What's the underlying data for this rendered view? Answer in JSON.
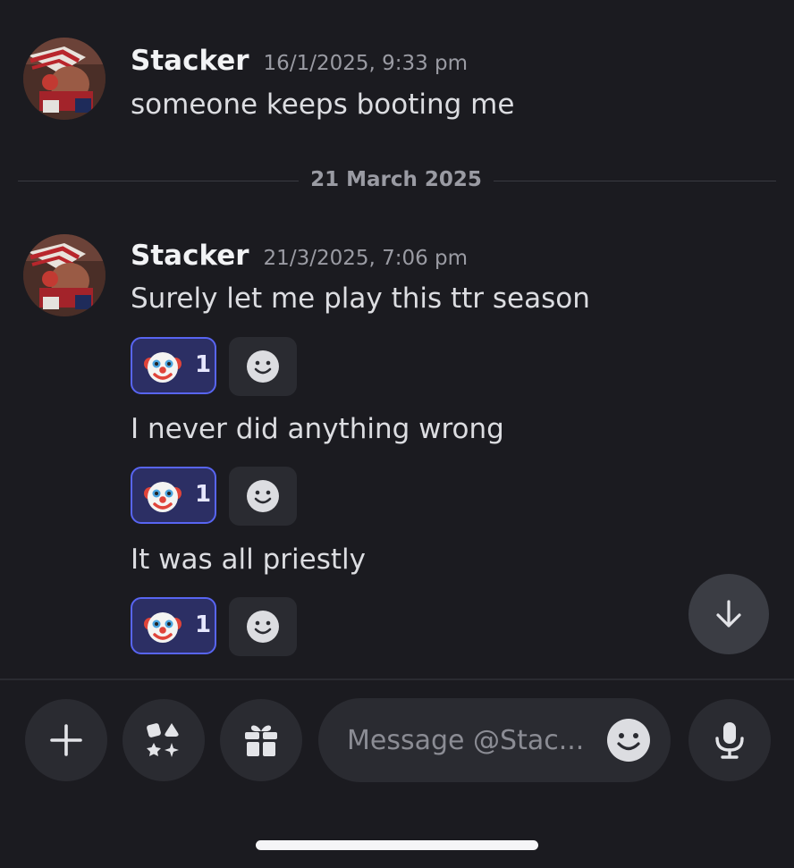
{
  "messages": [
    {
      "username": "Stacker",
      "timestamp": "16/1/2025, 9:33 pm",
      "lines": [
        {
          "text": "someone keeps booting me"
        }
      ]
    },
    {
      "username": "Stacker",
      "timestamp": "21/3/2025, 7:06 pm",
      "lines": [
        {
          "text": "Surely let me play this ttr season",
          "reaction": {
            "emoji": "clown-face-icon",
            "count": "1"
          }
        },
        {
          "text": "I never did anything wrong",
          "reaction": {
            "emoji": "clown-face-icon",
            "count": "1"
          }
        },
        {
          "text": "It was all priestly",
          "reaction": {
            "emoji": "clown-face-icon",
            "count": "1"
          }
        }
      ]
    }
  ],
  "date_divider": "21 March 2025",
  "composer": {
    "placeholder": "Message @Stac..."
  },
  "colors": {
    "background": "#1b1b20",
    "accent": "#5865f2",
    "reaction_fill": "#2c2f64"
  }
}
